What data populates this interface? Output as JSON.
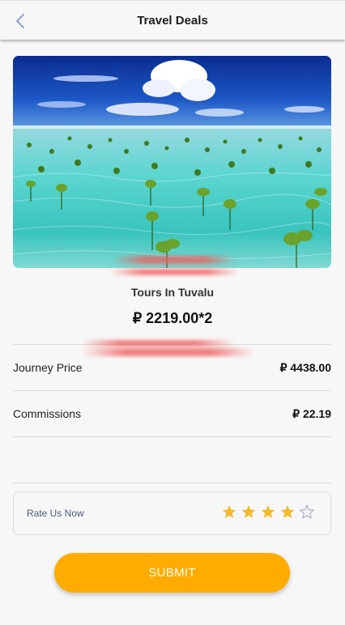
{
  "header": {
    "title": "Travel Deals",
    "back_icon": "chevron-left-icon"
  },
  "deal": {
    "image_description": "tropical-lagoon-photo",
    "name": "Tours In Tuvalu",
    "price": "₽ 2219.00*2"
  },
  "details": [
    {
      "label": "Journey Price",
      "value": "₽ 4438.00"
    },
    {
      "label": "Commissions",
      "value": "₽ 22.19"
    }
  ],
  "rating": {
    "label": "Rate Us Now",
    "value": 4,
    "max": 5,
    "filled_color": "#f5b92a",
    "empty_color": "#aab3c3"
  },
  "submit": {
    "label": "SUBMIT",
    "color": "#ffab00"
  }
}
